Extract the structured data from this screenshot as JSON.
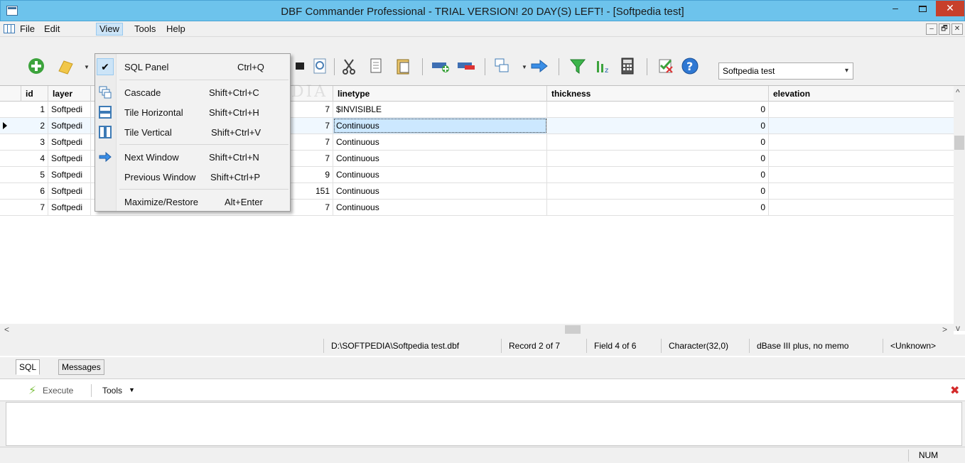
{
  "window": {
    "title": "DBF Commander Professional - TRIAL VERSION! 20 DAY(S) LEFT! - [Softpedia test]",
    "minimize": "–",
    "close": "✕"
  },
  "menubar": {
    "items": [
      "File",
      "Edit",
      "View",
      "Tools",
      "Help"
    ],
    "active": "View",
    "mdi_buttons": [
      "–",
      "🗗",
      "✕"
    ]
  },
  "view_menu": {
    "items": [
      {
        "label": "SQL Panel",
        "shortcut": "Ctrl+Q",
        "checked": true
      },
      {
        "label": "Cascade",
        "shortcut": "Shift+Ctrl+C"
      },
      {
        "label": "Tile Horizontal",
        "shortcut": "Shift+Ctrl+H"
      },
      {
        "label": "Tile Vertical",
        "shortcut": "Shift+Ctrl+V"
      },
      {
        "label": "Next Window",
        "shortcut": "Shift+Ctrl+N"
      },
      {
        "label": "Previous Window",
        "shortcut": "Shift+Ctrl+P"
      },
      {
        "label": "Maximize/Restore",
        "shortcut": "Alt+Enter"
      }
    ],
    "check_glyph": "✔"
  },
  "toolbar": {
    "database_combo": "Softpedia test"
  },
  "grid": {
    "columns": [
      "id",
      "layer",
      "linetype",
      "thickness",
      "elevation"
    ],
    "rows": [
      {
        "id": "1",
        "layer": "Softpedi",
        "color": "7",
        "linetype": "$INVISIBLE",
        "thickness": "0"
      },
      {
        "id": "2",
        "layer": "Softpedi",
        "color": "7",
        "linetype": "Continuous",
        "thickness": "0"
      },
      {
        "id": "3",
        "layer": "Softpedi",
        "color": "7",
        "linetype": "Continuous",
        "thickness": "0"
      },
      {
        "id": "4",
        "layer": "Softpedi",
        "color": "7",
        "linetype": "Continuous",
        "thickness": "0"
      },
      {
        "id": "5",
        "layer": "Softpedi",
        "color": "9",
        "linetype": "Continuous",
        "thickness": "0"
      },
      {
        "id": "6",
        "layer": "Softpedi",
        "color": "151",
        "linetype": "Continuous",
        "thickness": "0"
      },
      {
        "id": "7",
        "layer": "Softpedi",
        "color": "7",
        "linetype": "Continuous",
        "thickness": "0"
      }
    ],
    "selected_row": 2,
    "scroll_left": "<",
    "scroll_right": ">",
    "scroll_up": "^",
    "scroll_down": "v"
  },
  "grid_status": {
    "file": "D:\\SOFTPEDIA\\Softpedia test.dbf",
    "record": "Record 2 of 7",
    "field": "Field 4 of 6",
    "type": "Character(32,0)",
    "format": "dBase III plus, no memo",
    "codepage": "<Unknown>"
  },
  "sql_panel": {
    "tabs": [
      "SQL",
      "Messages"
    ],
    "active_tab": "SQL",
    "execute": "Execute",
    "tools": "Tools",
    "tools_arrow": "▼",
    "close": "✖"
  },
  "statusbar": {
    "num": "NUM"
  },
  "watermark": "SOFTPEDIA",
  "colors": {
    "titlebar": "#6dc3ec",
    "close_button": "#c7402b",
    "menu_highlight": "#cce4f7",
    "selected_cell": "#cce8ff"
  }
}
